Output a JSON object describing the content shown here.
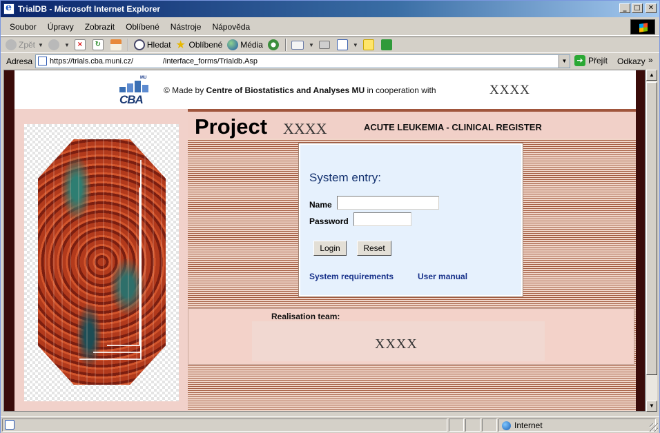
{
  "window": {
    "title": "TrialDB - Microsoft Internet Explorer"
  },
  "menu": [
    "Soubor",
    "Úpravy",
    "Zobrazit",
    "Oblíbené",
    "Nástroje",
    "Nápověda"
  ],
  "toolbar": {
    "back": "Zpět",
    "search": "Hledat",
    "favorites": "Oblíbené",
    "media": "Média"
  },
  "address": {
    "label": "Adresa",
    "url": "https://trials.cba.muni.cz/              /interface_forms/Trialdb.Asp",
    "go": "Přejít",
    "links": "Odkazy"
  },
  "banner": {
    "logo_text": "CBA",
    "logo_mu": "MU",
    "copyright_prefix": "© Made by ",
    "org": "Centre of Biostatistics and Analyses MU",
    "suffix": " in cooperation with",
    "partner": "XXXX"
  },
  "project": {
    "title": "Project",
    "name": "XXXX",
    "register": "ACUTE LEUKEMIA - CLINICAL REGISTER"
  },
  "login": {
    "heading": "System entry:",
    "name_label": "Name",
    "name_value": "",
    "password_label": "Password",
    "password_value": "",
    "login_button": "Login",
    "reset_button": "Reset",
    "requirements_link": "System requirements",
    "manual_link": "User manual"
  },
  "team": {
    "label": "Realisation team:",
    "name": "XXXX"
  },
  "status": {
    "zone": "Internet"
  },
  "colors": {
    "title_bar": "#0a246a",
    "link": "#17318a",
    "login_bg": "#e6f1fd",
    "stripe_dark": "#a25a3f"
  }
}
